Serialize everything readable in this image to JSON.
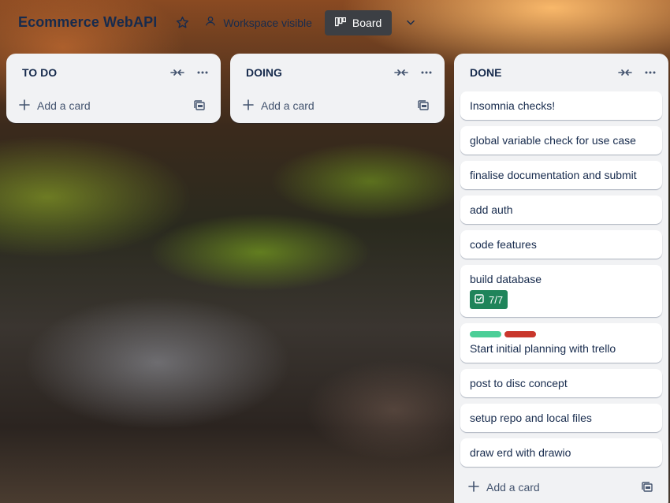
{
  "board": {
    "title": "Ecommerce WebAPI",
    "visibility_label": "Workspace visible",
    "view_label": "Board"
  },
  "lists": [
    {
      "title": "TO DO",
      "add_label": "Add a card"
    },
    {
      "title": "DOING",
      "add_label": "Add a card"
    },
    {
      "title": "DONE",
      "add_label": "Add a card",
      "cards": [
        {
          "title": "Insomnia checks!"
        },
        {
          "title": "global variable check for use case"
        },
        {
          "title": "finalise documentation and submit"
        },
        {
          "title": "add auth"
        },
        {
          "title": "code features"
        },
        {
          "title": "build database",
          "checklist": "7/7"
        },
        {
          "title": "Start initial planning with trello",
          "labels": [
            "#4bce97",
            "#c9372c"
          ]
        },
        {
          "title": "post to disc concept"
        },
        {
          "title": "setup repo and local files"
        },
        {
          "title": "draw erd with drawio"
        }
      ]
    }
  ],
  "colors": {
    "list_bg": "#f1f2f4",
    "text": "#172b4d",
    "checklist_complete": "#1f845a",
    "label_green": "#4bce97",
    "label_red": "#c9372c"
  }
}
